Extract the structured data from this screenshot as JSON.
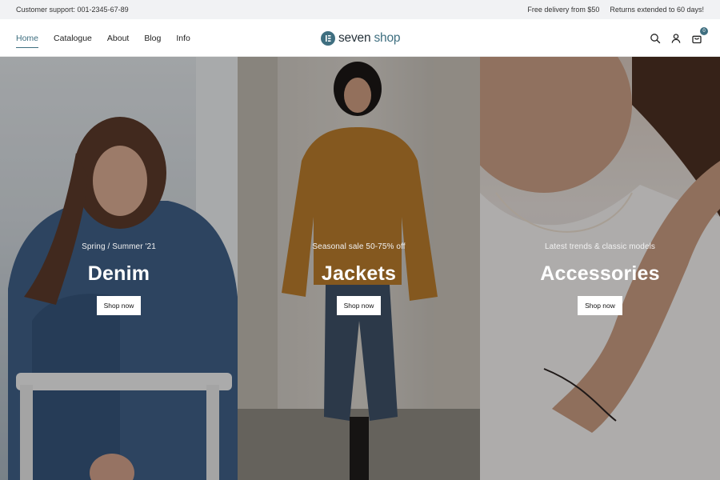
{
  "topbar": {
    "support": "Customer support: 001-2345-67-89",
    "delivery": "Free delivery from $50",
    "returns": "Returns extended to 60 days!"
  },
  "nav": {
    "items": [
      "Home",
      "Catalogue",
      "About",
      "Blog",
      "Info"
    ],
    "active": "Home"
  },
  "logo": {
    "word1": "seven",
    "word2": "shop",
    "mark_icon": "logo-e-icon"
  },
  "header_icons": {
    "search": "search-icon",
    "account": "user-icon",
    "cart": "cart-icon",
    "cart_count": "0"
  },
  "hero": {
    "panels": [
      {
        "kicker": "Spring / Summer '21",
        "title": "Denim",
        "button": "Shop now"
      },
      {
        "kicker": "Seasonal sale 50-75% off",
        "title": "Jackets",
        "button": "Shop now"
      },
      {
        "kicker": "Latest trends & classic models",
        "title": "Accessories",
        "button": "Shop now"
      }
    ]
  },
  "colors": {
    "accent": "#3f6f80",
    "topbar_bg": "#f1f2f4"
  }
}
